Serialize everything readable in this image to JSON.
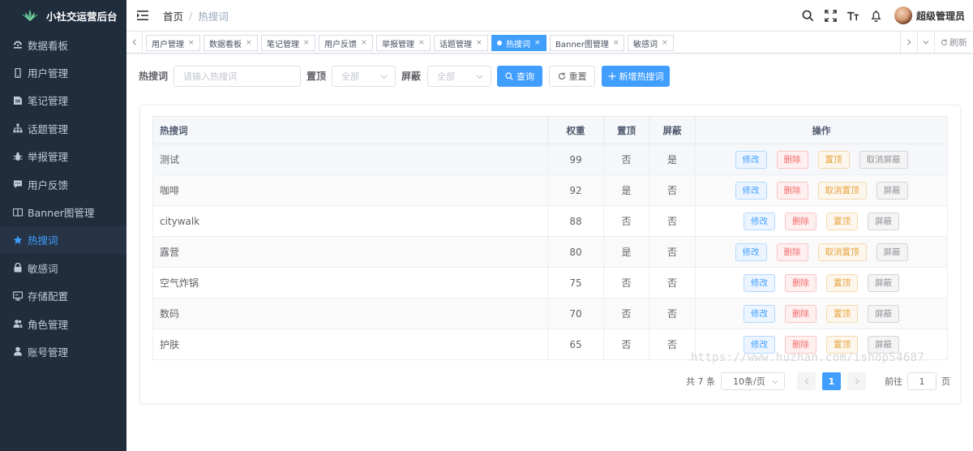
{
  "app": {
    "title": "小社交运营后台"
  },
  "colors": {
    "sidebar_bg": "#1f2d3d",
    "accent": "#409eff",
    "danger": "#f56c6c",
    "warning": "#e6a23c",
    "info": "#909399"
  },
  "sidebar": {
    "items": [
      {
        "label": "数据看板",
        "icon": "dashboard-icon",
        "active": false
      },
      {
        "label": "用户管理",
        "icon": "phone-icon",
        "active": false
      },
      {
        "label": "笔记管理",
        "icon": "document-icon",
        "active": false
      },
      {
        "label": "话题管理",
        "icon": "tree-icon",
        "active": false
      },
      {
        "label": "举报管理",
        "icon": "bug-icon",
        "active": false
      },
      {
        "label": "用户反馈",
        "icon": "chat-icon",
        "active": false
      },
      {
        "label": "Banner图管理",
        "icon": "book-icon",
        "active": false
      },
      {
        "label": "热搜词",
        "icon": "star-icon",
        "active": true
      },
      {
        "label": "敏感词",
        "icon": "lock-icon",
        "active": false
      },
      {
        "label": "存储配置",
        "icon": "monitor-icon",
        "active": false
      },
      {
        "label": "角色管理",
        "icon": "peoples-icon",
        "active": false
      },
      {
        "label": "账号管理",
        "icon": "user-icon",
        "active": false
      }
    ]
  },
  "navbar": {
    "breadcrumb": {
      "home": "首页",
      "separator": "/",
      "current": "热搜词"
    },
    "user_name": "超级管理员"
  },
  "tags": [
    {
      "label": "用户管理",
      "active": false
    },
    {
      "label": "数据看板",
      "active": false
    },
    {
      "label": "笔记管理",
      "active": false
    },
    {
      "label": "用户反馈",
      "active": false
    },
    {
      "label": "举报管理",
      "active": false
    },
    {
      "label": "话题管理",
      "active": false
    },
    {
      "label": "热搜词",
      "active": true
    },
    {
      "label": "Banner图管理",
      "active": false
    },
    {
      "label": "敏感词",
      "active": false
    }
  ],
  "tags_view": {
    "refresh_label": "刷新",
    "close_glyph": "×"
  },
  "filter": {
    "keyword_label": "热搜词",
    "keyword_placeholder": "请输入热搜词",
    "pin_label": "置顶",
    "pin_value": "全部",
    "hide_label": "屏蔽",
    "hide_value": "全部",
    "search_label": "查询",
    "reset_label": "重置",
    "add_label": "新增热搜词"
  },
  "table": {
    "headers": {
      "word": "热搜词",
      "weight": "权重",
      "pinned": "置顶",
      "hidden": "屏蔽",
      "actions": "操作"
    },
    "rows": [
      {
        "word": "测试",
        "weight": "99",
        "pinned": "否",
        "hidden": "是",
        "edit": "修改",
        "del": "删除",
        "pin_action": "置顶",
        "hide_action": "取消屏蔽"
      },
      {
        "word": "咖啡",
        "weight": "92",
        "pinned": "是",
        "hidden": "否",
        "edit": "修改",
        "del": "删除",
        "pin_action": "取消置顶",
        "hide_action": "屏蔽"
      },
      {
        "word": "citywalk",
        "weight": "88",
        "pinned": "否",
        "hidden": "否",
        "edit": "修改",
        "del": "删除",
        "pin_action": "置顶",
        "hide_action": "屏蔽"
      },
      {
        "word": "露营",
        "weight": "80",
        "pinned": "是",
        "hidden": "否",
        "edit": "修改",
        "del": "删除",
        "pin_action": "取消置顶",
        "hide_action": "屏蔽"
      },
      {
        "word": "空气炸锅",
        "weight": "75",
        "pinned": "否",
        "hidden": "否",
        "edit": "修改",
        "del": "删除",
        "pin_action": "置顶",
        "hide_action": "屏蔽"
      },
      {
        "word": "数码",
        "weight": "70",
        "pinned": "否",
        "hidden": "否",
        "edit": "修改",
        "del": "删除",
        "pin_action": "置顶",
        "hide_action": "屏蔽"
      },
      {
        "word": "护肤",
        "weight": "65",
        "pinned": "否",
        "hidden": "否",
        "edit": "修改",
        "del": "删除",
        "pin_action": "置顶",
        "hide_action": "屏蔽"
      }
    ]
  },
  "pagination": {
    "total": "共 7 条",
    "page_size": "10条/页",
    "current_page": "1",
    "goto_prefix": "前往",
    "goto_value": "1",
    "goto_suffix": "页"
  },
  "watermark": "https://www.huzhan.com/ishop54687"
}
